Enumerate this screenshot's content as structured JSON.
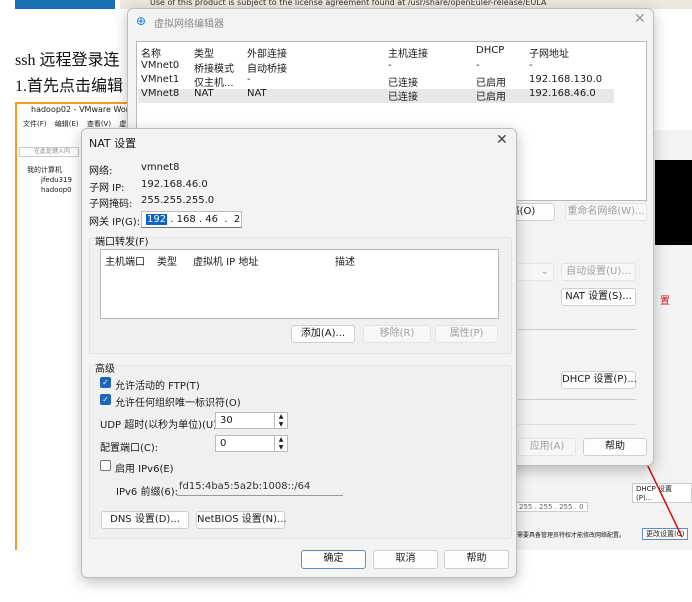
{
  "banner": {
    "text": "Use of this product is subject to the license agreement found at /usr/share/openEuler-release/EULA"
  },
  "doc": {
    "line1": "ssh 远程登录连",
    "line2": "1.首先点击编辑"
  },
  "vmware": {
    "title": "hadoop02 - VMware Work",
    "menu": "文件(F) 编辑(E) 查看(V) 虚",
    "search_placeholder": "在此处键入内",
    "tree": [
      "我的计算机",
      "jfedu319",
      "hadoop0"
    ]
  },
  "bg_right": {
    "netmask": "255 . 255 . 255 . 0",
    "admin_note": "需要具备管理员特权才能修改网络配置。",
    "change_settings": "更改设置(C)",
    "dhcp": "DHCP 设置(P)...",
    "red_text": "置"
  },
  "vne": {
    "title": "虚拟网络编辑器",
    "columns": [
      "名称",
      "类型",
      "外部连接",
      "主机连接",
      "DHCP",
      "子网地址"
    ],
    "rows": [
      [
        "VMnet0",
        "桥接模式",
        "自动桥接",
        "-",
        "-",
        "-"
      ],
      [
        "VMnet1",
        "仅主机...",
        "-",
        "已连接",
        "已启用",
        "192.168.130.0"
      ],
      [
        "VMnet8",
        "NAT",
        "NAT",
        "已连接",
        "已启用",
        "192.168.46.0"
      ]
    ],
    "remove_network": "网络(O)",
    "rename_network": "重命名网络(W)...",
    "auto_settings": "自动设置(U)...",
    "nat_settings": "NAT 设置(S)...",
    "dhcp_settings": "DHCP 设置(P)...",
    "apply": "应用(A)",
    "help": "帮助"
  },
  "nat": {
    "title": "NAT 设置",
    "network_label": "网络:",
    "network": "vmnet8",
    "subnet_ip_label": "子网 IP:",
    "subnet_ip": "192.168.46.0",
    "subnet_mask_label": "子网掩码:",
    "subnet_mask": "255.255.255.0",
    "gateway_label": "网关 IP(G):",
    "gateway": [
      "192",
      "168",
      "46",
      "2"
    ],
    "port_forwarding": "端口转发(F)",
    "pf_columns": [
      "主机端口",
      "类型",
      "虚拟机 IP 地址",
      "描述"
    ],
    "add": "添加(A)...",
    "remove": "移除(R)",
    "properties": "属性(P)",
    "advanced": "高级",
    "allow_ftp": "允许活动的 FTP(T)",
    "allow_ftp_checked": true,
    "allow_oui": "允许任何组织唯一标识符(O)",
    "allow_oui_checked": true,
    "udp_label": "UDP 超时(以秒为单位)(U):",
    "udp": "30",
    "config_port_label": "配置端口(C):",
    "config_port": "0",
    "ipv6_label": "启用 IPv6(E)",
    "ipv6_checked": false,
    "ipv6_prefix_label": "IPv6 前缀(6):",
    "ipv6_prefix": "fd15:4ba5:5a2b:1008::/64",
    "dns": "DNS 设置(D)...",
    "netbios": "NetBIOS 设置(N)...",
    "ok": "确定",
    "cancel": "取消",
    "help": "帮助"
  },
  "colors": {
    "selection": "#0a64c8",
    "checkbox": "#1f66b8",
    "vmware_accent": "#f0a020",
    "arrow": "#d01010"
  }
}
